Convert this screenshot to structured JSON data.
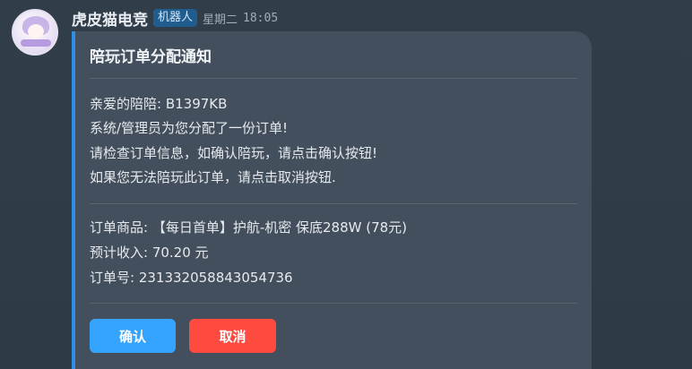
{
  "message": {
    "sender_name": "虎皮猫电竞",
    "bot_badge": "机器人",
    "weekday": "星期二",
    "time": "18:05"
  },
  "card": {
    "title": "陪玩订单分配通知",
    "greeting": "亲爱的陪陪: B1397KB",
    "line1": "系统/管理员为您分配了一份订单!",
    "line2": "请检查订单信息，如确认陪玩，请点击确认按钮!",
    "line3": "如果您无法陪玩此订单，请点击取消按钮.",
    "order_product": "订单商品: 【每日首单】护航-机密 保底288W (78元)",
    "expected_income": "预计收入: 70.20 元",
    "order_number": "订单号: 231332058843054736",
    "confirm_label": "确认",
    "cancel_label": "取消"
  },
  "colors": {
    "accent": "#2e8fe6",
    "confirm": "#34a4ff",
    "cancel": "#ff4a40",
    "card_bg": "#434f5c",
    "page_bg": "#2f3b47"
  }
}
